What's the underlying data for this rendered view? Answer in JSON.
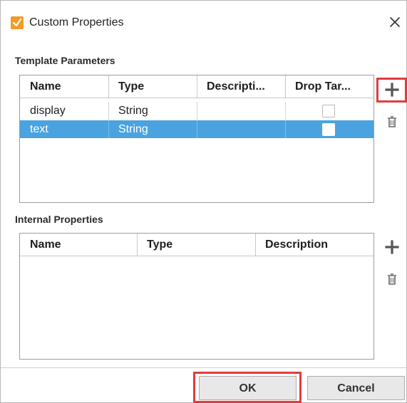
{
  "dialog": {
    "title": "Custom Properties",
    "icons": {
      "app": "checkmark-app-icon",
      "close": "close-icon"
    }
  },
  "template_parameters": {
    "label": "Template Parameters",
    "columns": [
      "Name",
      "Type",
      "Descripti...",
      "Drop Tar..."
    ],
    "rows": [
      {
        "name": "display",
        "type": "String",
        "description": "",
        "drop_target": false,
        "selected": false
      },
      {
        "name": "text",
        "type": "String",
        "description": "",
        "drop_target": false,
        "selected": true
      }
    ],
    "icons": {
      "add": "plus-icon",
      "delete": "trash-icon"
    }
  },
  "internal_properties": {
    "label": "Internal Properties",
    "columns": [
      "Name",
      "Type",
      "Description"
    ],
    "rows": [],
    "icons": {
      "add": "plus-icon",
      "delete": "trash-icon"
    }
  },
  "buttons": {
    "ok": "OK",
    "cancel": "Cancel"
  },
  "colors": {
    "selection": "#4aa3df",
    "highlight": "#e03c3c",
    "accent_icon": "#f29b26"
  }
}
